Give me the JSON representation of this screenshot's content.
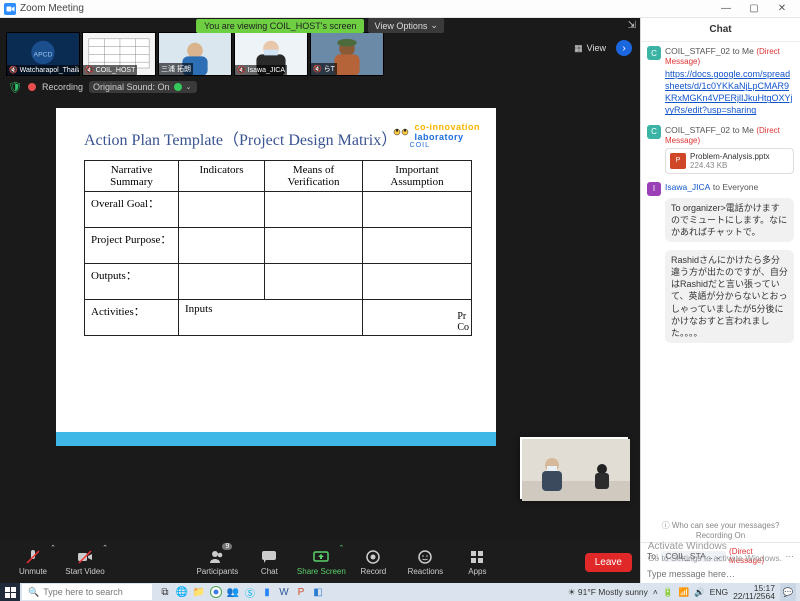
{
  "window": {
    "title": "Zoom Meeting"
  },
  "sharebar": {
    "viewing": "You are viewing COIL_HOST's screen",
    "view_options": "View Options"
  },
  "gallery": {
    "view_label": "View",
    "tiles": [
      {
        "name": "Watcharapol_Thailand"
      },
      {
        "name": "COIL_HOST"
      },
      {
        "name": "三浦 拓朗"
      },
      {
        "name": "Isawa_JICA"
      },
      {
        "name": "らT"
      }
    ]
  },
  "recording": {
    "label": "Recording",
    "sound": "Original Sound: On"
  },
  "slide": {
    "title": "Action Plan Template（Project Design Matrix）",
    "brand_top": "co-innovation",
    "brand_bottom": "laboratory",
    "coil": "COIL",
    "headers": [
      "Narrative Summary",
      "Indicators",
      "Means of Verification",
      "Important Assumption"
    ],
    "rows": [
      "Overall Goal：",
      "Project Purpose：",
      "Outputs：",
      "Activities："
    ],
    "inputs_label": "Inputs",
    "truncated": "Pr\nCo"
  },
  "toolbar": {
    "unmute": "Unmute",
    "video": "Start Video",
    "participants": "Participants",
    "participants_n": "9",
    "chat": "Chat",
    "share": "Share Screen",
    "record": "Record",
    "reactions": "Reactions",
    "apps": "Apps",
    "leave": "Leave"
  },
  "chat": {
    "header": "Chat",
    "m1_from": "COIL_STAFF_02",
    "m1_to": "to Me",
    "m1_direct": "(Direct Message)",
    "m1_link": "https://docs.google.com/spreadsheets/d/1c0YKKaNjLpCMAR9KRxMGKn4VPERjlIJkuHtgOXYjyyRs/edit?usp=sharing",
    "m2_from": "COIL_STAFF_02",
    "m2_to": "to Me",
    "m2_direct": "(Direct Message)",
    "m2_file": "Problem-Analysis.pptx",
    "m2_size": "224.43 KB",
    "m3_from": "Isawa_JICA",
    "m3_to": "to Everyone",
    "m3_body": "To organizer>電話かけますのでミュートにします。なにかあればチャットで。",
    "m4_body": "Rashidさんにかけたら多分違う方が出たのですが、自分はRashidだと言い張っていて、英語が分からないとおっしゃっていましたが5分後にかけなおすと言われました。。。。",
    "visibility": "Who can see your messages? Recording On",
    "to_label": "To:",
    "to_value": "COIL_STA...",
    "to_direct": "(Direct Message)",
    "placeholder": "Type message here…"
  },
  "activate": {
    "l1": "Activate Windows",
    "l2": "Go to Settings to activate Windows."
  },
  "taskbar": {
    "search": "Type here to search",
    "weather": "91°F  Mostly sunny",
    "lang": "ENG",
    "time": "15:17",
    "date": "22/11/2564"
  }
}
